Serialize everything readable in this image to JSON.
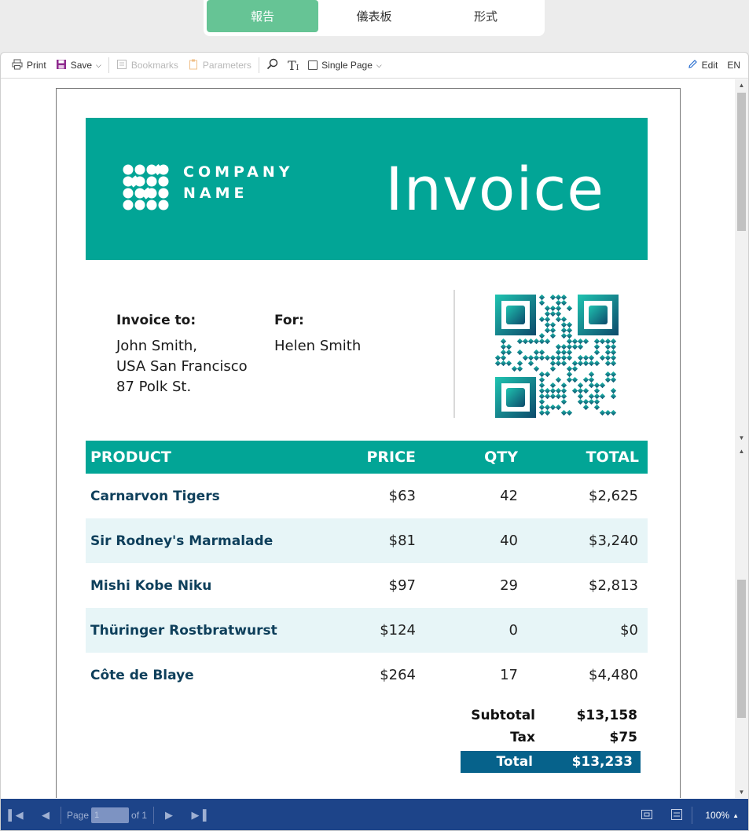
{
  "top_tabs": [
    {
      "label": "報告",
      "active": true
    },
    {
      "label": "儀表板",
      "active": false
    },
    {
      "label": "形式",
      "active": false
    }
  ],
  "toolbar": {
    "print": "Print",
    "save": "Save",
    "bookmarks": "Bookmarks",
    "parameters": "Parameters",
    "single_page": "Single Page",
    "edit": "Edit",
    "language": "EN"
  },
  "invoice": {
    "company_line1": "COMPANY",
    "company_line2": "NAME",
    "title": "Invoice",
    "invoice_to_label": "Invoice to:",
    "invoice_to_lines": [
      "John Smith,",
      "USA San Francisco",
      "87 Polk St."
    ],
    "for_label": "For:",
    "for_name": "Helen Smith",
    "columns": [
      "PRODUCT",
      "PRICE",
      "QTY",
      "TOTAL"
    ],
    "rows": [
      {
        "product": "Carnarvon Tigers",
        "price": "$63",
        "qty": "42",
        "total": "$2,625"
      },
      {
        "product": "Sir Rodney's Marmalade",
        "price": "$81",
        "qty": "40",
        "total": "$3,240"
      },
      {
        "product": "Mishi Kobe Niku",
        "price": "$97",
        "qty": "29",
        "total": "$2,813"
      },
      {
        "product": "Thüringer Rostbratwurst",
        "price": "$124",
        "qty": "0",
        "total": "$0"
      },
      {
        "product": "Côte de Blaye",
        "price": "$264",
        "qty": "17",
        "total": "$4,480"
      }
    ],
    "subtotal_label": "Subtotal",
    "subtotal": "$13,158",
    "tax_label": "Tax",
    "tax": "$75",
    "total_label": "Total",
    "total": "$13,233"
  },
  "pager": {
    "page_label": "Page",
    "page_value": "1",
    "of_label": "of 1",
    "zoom": "100%"
  },
  "colors": {
    "brand_teal": "#02a596",
    "tab_active": "#66c495",
    "bottom_bar": "#1d4489",
    "total_bar": "#06628b",
    "alt_row": "#e7f5f7"
  }
}
